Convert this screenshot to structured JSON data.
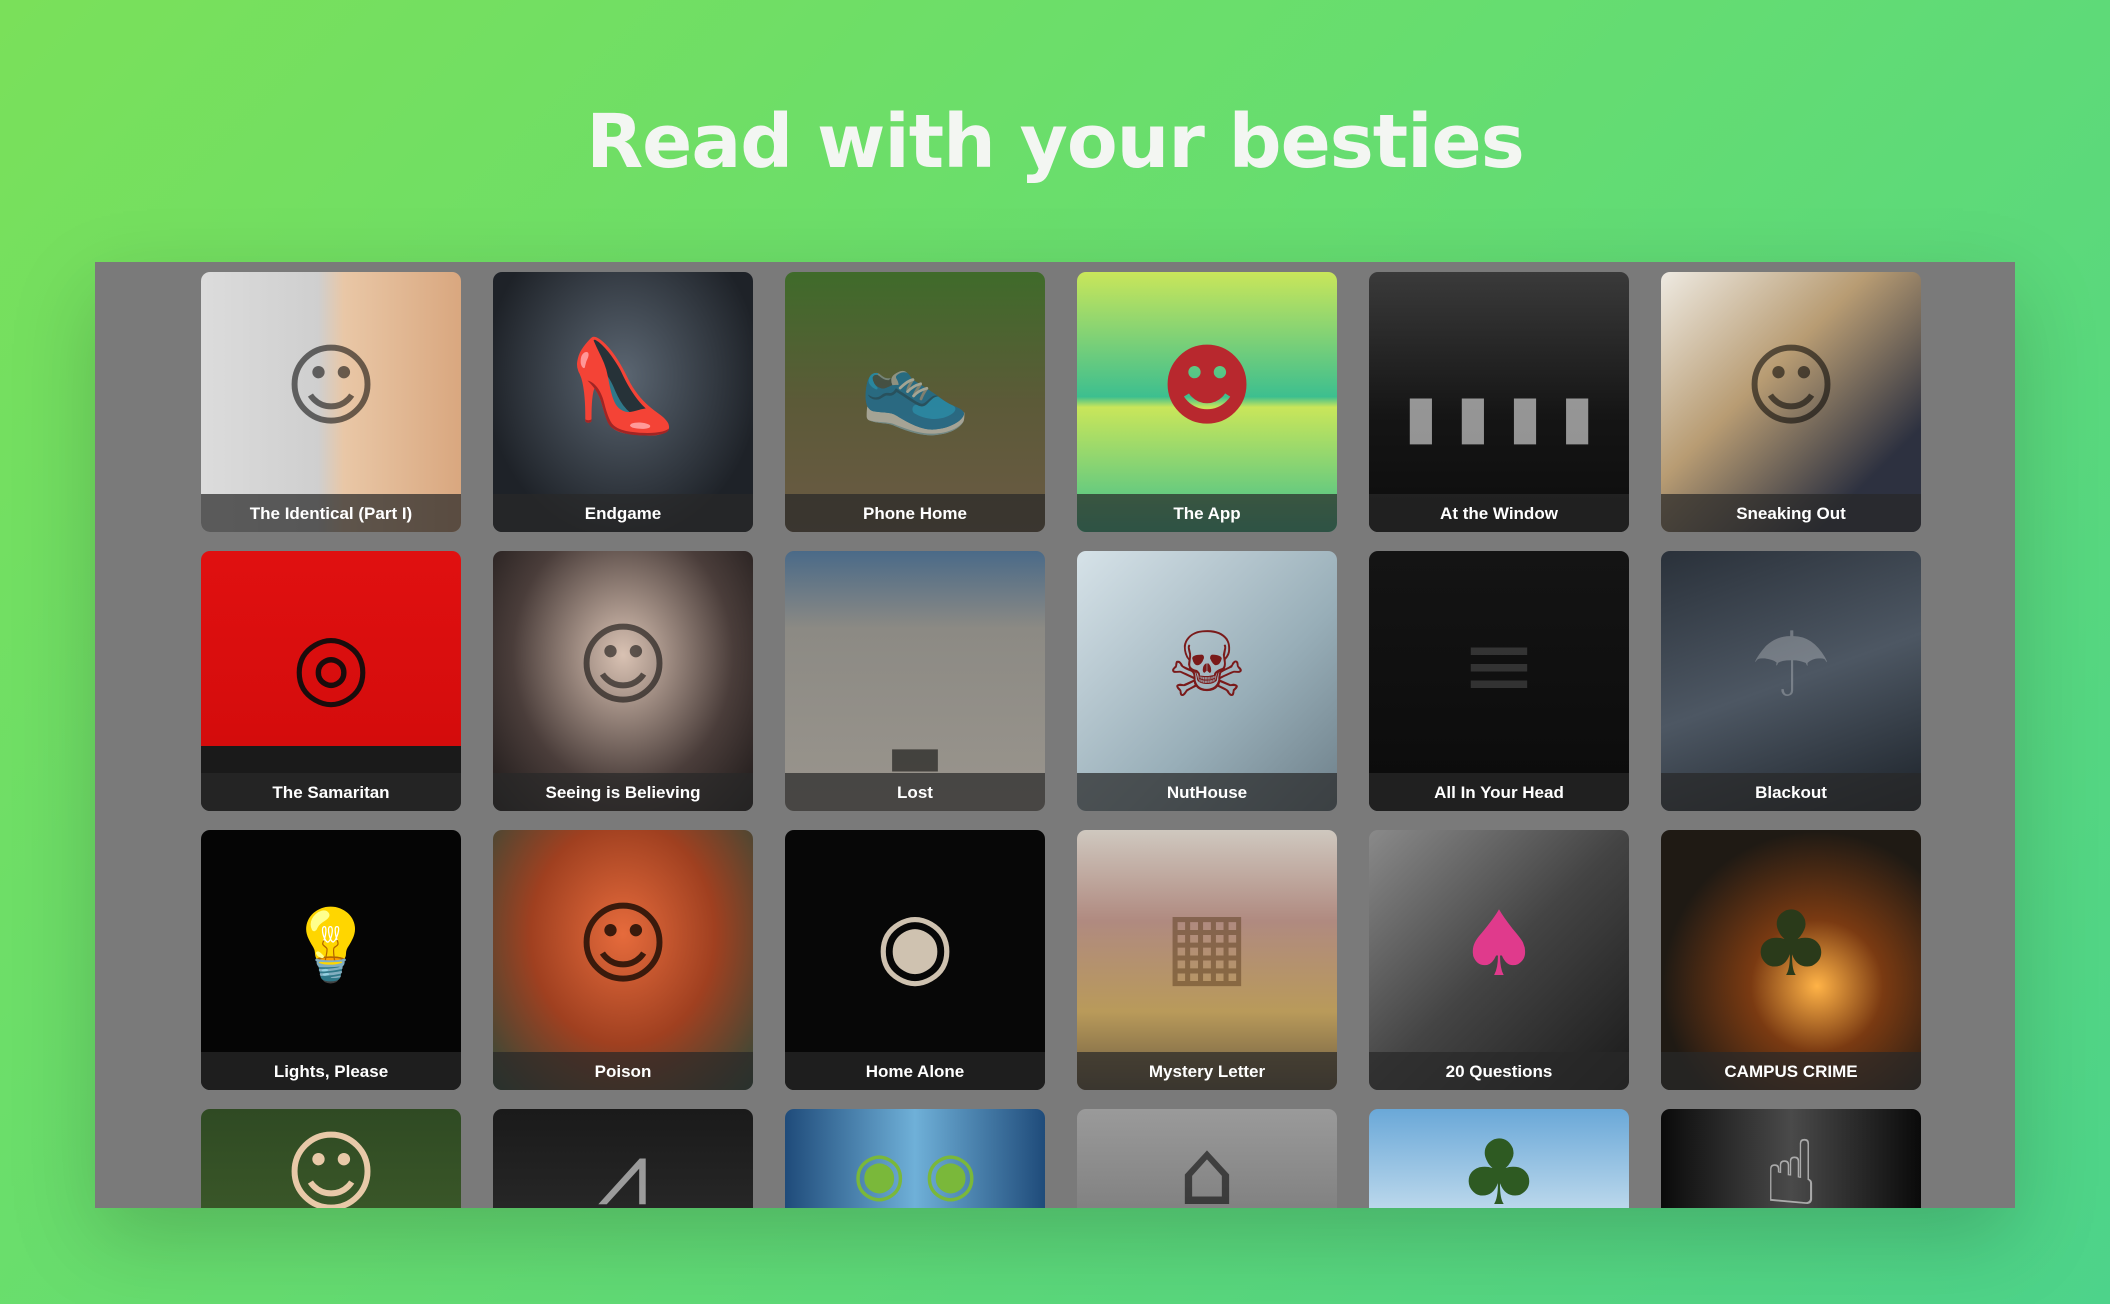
{
  "headline": "Read with your besties",
  "stories": [
    {
      "title": "The Identical (Part I)",
      "icon": "face-icon"
    },
    {
      "title": "Endgame",
      "icon": "heels-handcuffs-icon"
    },
    {
      "title": "Phone Home",
      "icon": "sneaker-icon"
    },
    {
      "title": "The App",
      "icon": "cartoon-phone-icon"
    },
    {
      "title": "At the Window",
      "icon": "dark-house-icon"
    },
    {
      "title": "Sneaking Out",
      "icon": "couple-icon"
    },
    {
      "title": "The Samaritan",
      "icon": "target-icon"
    },
    {
      "title": "Seeing is Believing",
      "icon": "girl-portrait-icon"
    },
    {
      "title": "Lost",
      "icon": "dropped-phone-icon"
    },
    {
      "title": "NutHouse",
      "icon": "asylum-icon"
    },
    {
      "title": "All In Your Head",
      "icon": "staircase-icon"
    },
    {
      "title": "Blackout",
      "icon": "rainy-window-icon"
    },
    {
      "title": "Lights, Please",
      "icon": "lightbulb-icon"
    },
    {
      "title": "Poison",
      "icon": "red-hair-icon"
    },
    {
      "title": "Home Alone",
      "icon": "peeking-eye-icon"
    },
    {
      "title": "Mystery Letter",
      "icon": "abandoned-room-icon"
    },
    {
      "title": "20 Questions",
      "icon": "shovel-icon"
    },
    {
      "title": "CAMPUS CRIME",
      "icon": "campus-night-icon"
    },
    {
      "title": "",
      "icon": "forest-girl-icon"
    },
    {
      "title": "",
      "icon": "hooded-figure-icon"
    },
    {
      "title": "",
      "icon": "blue-eyes-icon"
    },
    {
      "title": "",
      "icon": "old-house-icon"
    },
    {
      "title": "",
      "icon": "trees-icon"
    },
    {
      "title": "",
      "icon": "shush-icon"
    }
  ]
}
